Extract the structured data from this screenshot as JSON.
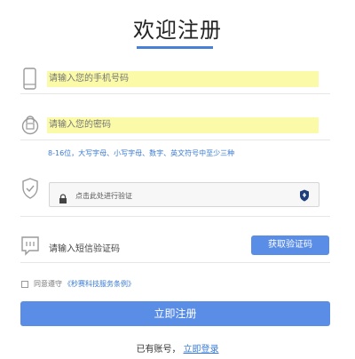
{
  "header": {
    "title": "欢迎注册",
    "accent_color": "#4a7fd6"
  },
  "form": {
    "phone": {
      "placeholder": "请输入您的手机号码",
      "icon": "phone-icon"
    },
    "password": {
      "placeholder": "请输入您的密码",
      "icon": "lock-icon"
    },
    "password_hint": "8-16位，大写字母、小写字母、数字、英文符号中至少三种",
    "captcha": {
      "icon": "shield-check-icon",
      "text": "点击此处进行验证"
    },
    "sms": {
      "label": "请输入短信验证码",
      "button": "获取验证码",
      "icon": "message-icon"
    },
    "agreement": {
      "prefix": "同意遵守",
      "link": "《秒赛科技服务条例》"
    },
    "submit": "立即注册",
    "login_prompt": "已有账号，",
    "login_link": "立即登录"
  },
  "colors": {
    "button": "#5a8de6",
    "link": "#3a7bd5",
    "highlight": "#fafaa8"
  }
}
